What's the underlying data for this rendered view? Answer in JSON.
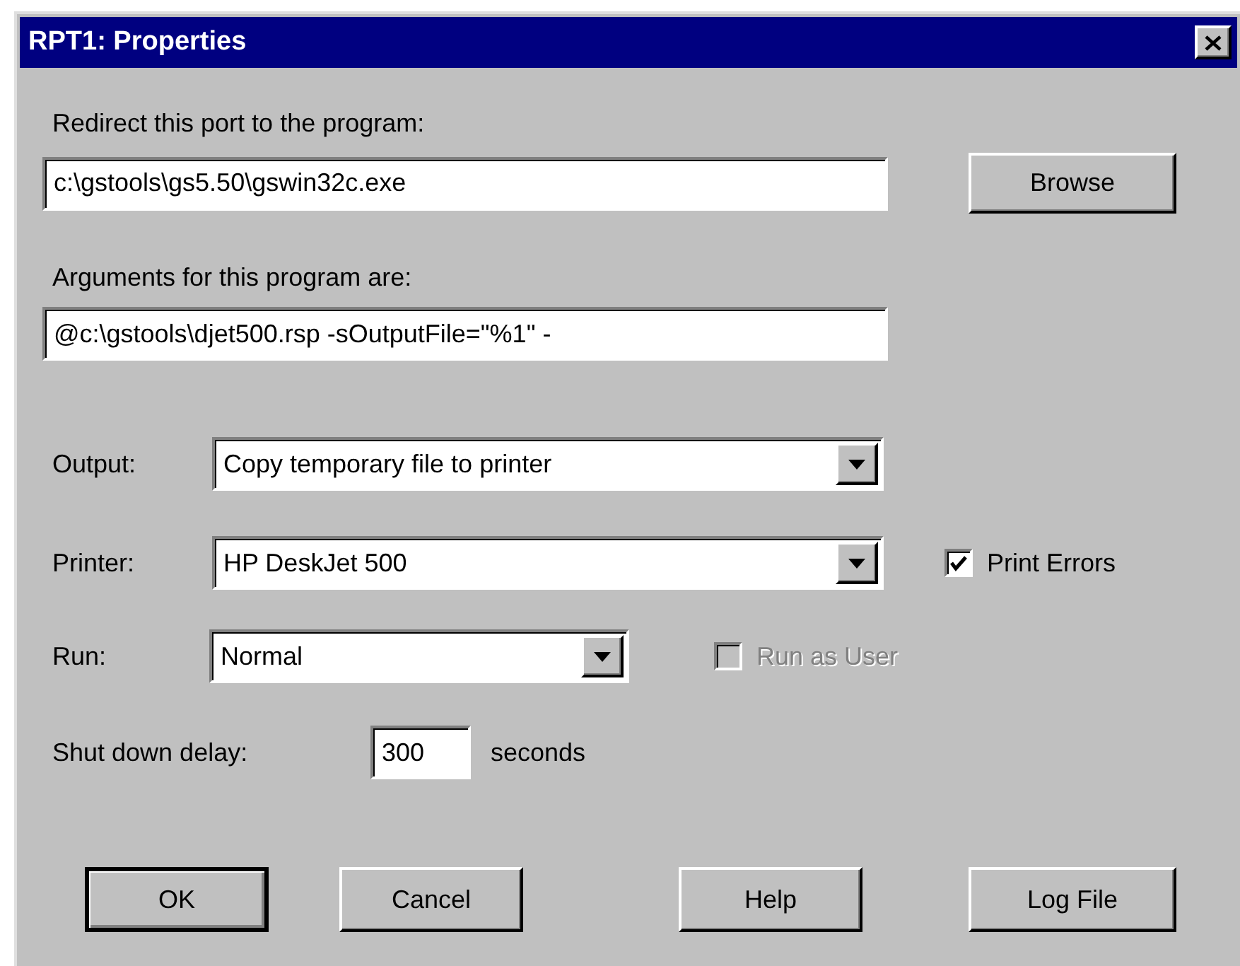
{
  "window": {
    "title": "RPT1: Properties"
  },
  "program": {
    "label": "Redirect this port to the program:",
    "value": "c:\\gstools\\gs5.50\\gswin32c.exe"
  },
  "browse_button": "Browse",
  "arguments": {
    "label": "Arguments for this program are:",
    "value": "@c:\\gstools\\djet500.rsp -sOutputFile=\"%1\" -"
  },
  "output": {
    "label": "Output:",
    "value": "Copy temporary file to printer"
  },
  "printer": {
    "label": "Printer:",
    "value": "HP DeskJet 500"
  },
  "print_errors": {
    "label": "Print Errors",
    "checked": true,
    "disabled": false
  },
  "run": {
    "label": "Run:",
    "value": "Normal"
  },
  "run_as_user": {
    "label": "Run as User",
    "checked": false,
    "disabled": true
  },
  "shutdown": {
    "label": "Shut down delay:",
    "value": "300",
    "unit": "seconds"
  },
  "buttons": [
    {
      "label": "OK",
      "default": true
    },
    {
      "label": "Cancel",
      "default": false
    },
    {
      "label": "Help",
      "default": false
    },
    {
      "label": "Log File",
      "default": false
    }
  ]
}
